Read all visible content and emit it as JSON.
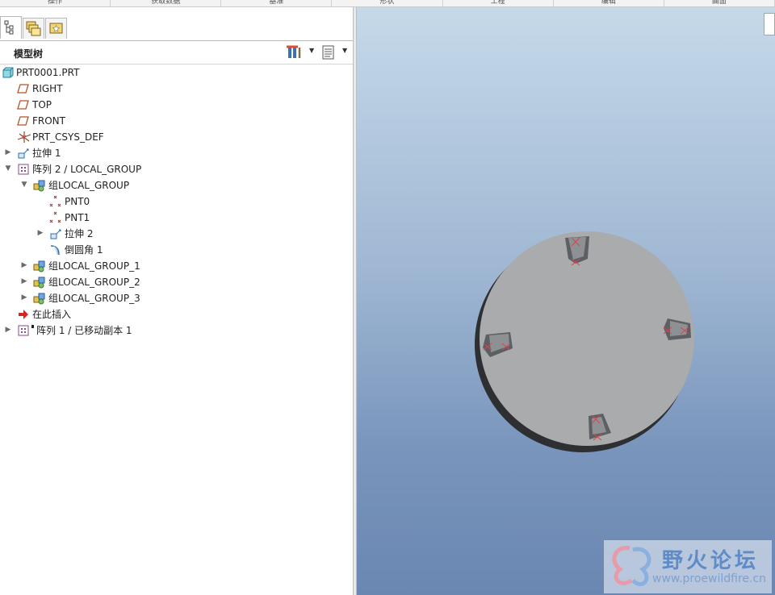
{
  "ribbon": {
    "tabs": [
      "操作",
      "获取数据",
      "基准",
      "形状",
      "工程",
      "编辑",
      "曲面"
    ]
  },
  "navigator": {
    "tabs": [
      "model-tree-tab",
      "folder-browser-tab",
      "favorites-tab"
    ]
  },
  "tree_header": {
    "title": "模型树"
  },
  "tree": {
    "items": [
      {
        "label": "PRT0001.PRT"
      },
      {
        "label": "RIGHT"
      },
      {
        "label": "TOP"
      },
      {
        "label": "FRONT"
      },
      {
        "label": "PRT_CSYS_DEF"
      },
      {
        "label": "拉伸 1"
      },
      {
        "label": "阵列 2 / LOCAL_GROUP"
      },
      {
        "label": "组LOCAL_GROUP"
      },
      {
        "label": "PNT0"
      },
      {
        "label": "PNT1"
      },
      {
        "label": "拉伸 2"
      },
      {
        "label": "倒圆角 1"
      },
      {
        "label": "组LOCAL_GROUP_1"
      },
      {
        "label": "组LOCAL_GROUP_2"
      },
      {
        "label": "组LOCAL_GROUP_3"
      },
      {
        "label": "在此插入"
      },
      {
        "label": "阵列 1 / 已移动副本 1"
      }
    ]
  },
  "watermark": {
    "title": "野火论坛",
    "url": "www.proewildfire.cn"
  },
  "colors": {
    "viewport_top": "#c5d9e9",
    "viewport_bottom": "#6a87b2",
    "part": "#a9abad",
    "point_marker": "#d9434b"
  }
}
